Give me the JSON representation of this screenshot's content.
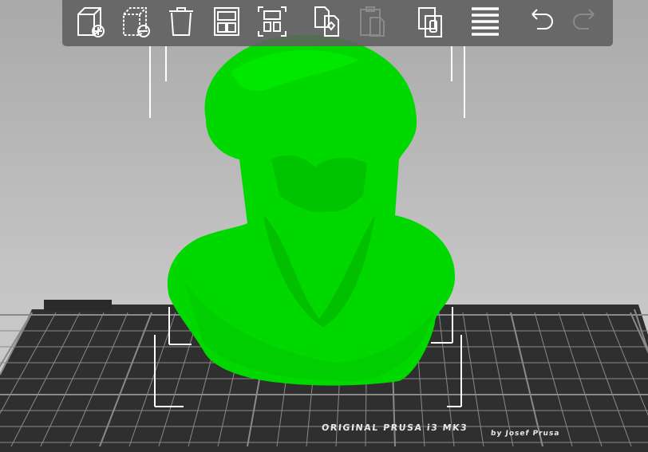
{
  "app": {
    "view": "3D scene"
  },
  "toolbar": {
    "buttons": [
      {
        "name": "add-icon",
        "label": "Add",
        "enabled": true
      },
      {
        "name": "delete-icon",
        "label": "Delete",
        "enabled": true
      },
      {
        "name": "delete-all-icon",
        "label": "Delete all",
        "enabled": true
      },
      {
        "name": "arrange-icon",
        "label": "Arrange",
        "enabled": true
      },
      {
        "name": "arrange-selection-icon",
        "label": "Arrange selection",
        "enabled": true
      },
      {
        "name": "copy-icon",
        "label": "Copy",
        "enabled": true
      },
      {
        "name": "paste-icon",
        "label": "Paste",
        "enabled": false
      },
      {
        "name": "instances-icon",
        "label": "Add instance",
        "enabled": true
      },
      {
        "name": "layers-icon",
        "label": "Layers editing",
        "enabled": true
      },
      {
        "name": "undo-icon",
        "label": "Undo",
        "enabled": true
      },
      {
        "name": "redo-icon",
        "label": "Redo",
        "enabled": false
      }
    ]
  },
  "bed": {
    "title": "ORIGINAL PRUSA i3  MK3",
    "subtitle": "by Josef Prusa"
  },
  "model": {
    "color": "#00e600"
  },
  "colors": {
    "toolbar": "#5f5f5f",
    "bed": "#313131",
    "grid": "#9a9a9a"
  }
}
